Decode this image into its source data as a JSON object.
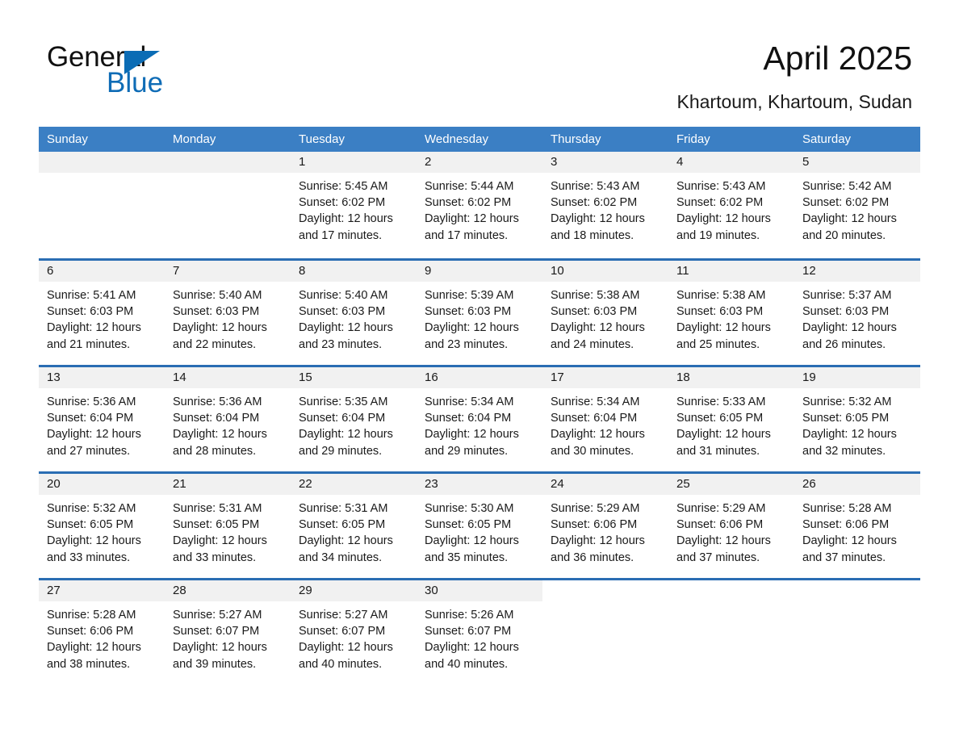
{
  "brand": {
    "name_part1": "General",
    "name_part2": "Blue",
    "accent_color": "#0f6cb6"
  },
  "header": {
    "title": "April 2025",
    "location": "Khartoum, Khartoum, Sudan"
  },
  "calendar": {
    "header_bg": "#3b7fc4",
    "row_divider_color": "#2a6db3",
    "daynum_bg": "#f1f1f1",
    "weekdays": [
      "Sunday",
      "Monday",
      "Tuesday",
      "Wednesday",
      "Thursday",
      "Friday",
      "Saturday"
    ],
    "weeks": [
      [
        {
          "day": "",
          "lines": []
        },
        {
          "day": "",
          "lines": []
        },
        {
          "day": "1",
          "lines": [
            "Sunrise: 5:45 AM",
            "Sunset: 6:02 PM",
            "Daylight: 12 hours",
            "and 17 minutes."
          ]
        },
        {
          "day": "2",
          "lines": [
            "Sunrise: 5:44 AM",
            "Sunset: 6:02 PM",
            "Daylight: 12 hours",
            "and 17 minutes."
          ]
        },
        {
          "day": "3",
          "lines": [
            "Sunrise: 5:43 AM",
            "Sunset: 6:02 PM",
            "Daylight: 12 hours",
            "and 18 minutes."
          ]
        },
        {
          "day": "4",
          "lines": [
            "Sunrise: 5:43 AM",
            "Sunset: 6:02 PM",
            "Daylight: 12 hours",
            "and 19 minutes."
          ]
        },
        {
          "day": "5",
          "lines": [
            "Sunrise: 5:42 AM",
            "Sunset: 6:02 PM",
            "Daylight: 12 hours",
            "and 20 minutes."
          ]
        }
      ],
      [
        {
          "day": "6",
          "lines": [
            "Sunrise: 5:41 AM",
            "Sunset: 6:03 PM",
            "Daylight: 12 hours",
            "and 21 minutes."
          ]
        },
        {
          "day": "7",
          "lines": [
            "Sunrise: 5:40 AM",
            "Sunset: 6:03 PM",
            "Daylight: 12 hours",
            "and 22 minutes."
          ]
        },
        {
          "day": "8",
          "lines": [
            "Sunrise: 5:40 AM",
            "Sunset: 6:03 PM",
            "Daylight: 12 hours",
            "and 23 minutes."
          ]
        },
        {
          "day": "9",
          "lines": [
            "Sunrise: 5:39 AM",
            "Sunset: 6:03 PM",
            "Daylight: 12 hours",
            "and 23 minutes."
          ]
        },
        {
          "day": "10",
          "lines": [
            "Sunrise: 5:38 AM",
            "Sunset: 6:03 PM",
            "Daylight: 12 hours",
            "and 24 minutes."
          ]
        },
        {
          "day": "11",
          "lines": [
            "Sunrise: 5:38 AM",
            "Sunset: 6:03 PM",
            "Daylight: 12 hours",
            "and 25 minutes."
          ]
        },
        {
          "day": "12",
          "lines": [
            "Sunrise: 5:37 AM",
            "Sunset: 6:03 PM",
            "Daylight: 12 hours",
            "and 26 minutes."
          ]
        }
      ],
      [
        {
          "day": "13",
          "lines": [
            "Sunrise: 5:36 AM",
            "Sunset: 6:04 PM",
            "Daylight: 12 hours",
            "and 27 minutes."
          ]
        },
        {
          "day": "14",
          "lines": [
            "Sunrise: 5:36 AM",
            "Sunset: 6:04 PM",
            "Daylight: 12 hours",
            "and 28 minutes."
          ]
        },
        {
          "day": "15",
          "lines": [
            "Sunrise: 5:35 AM",
            "Sunset: 6:04 PM",
            "Daylight: 12 hours",
            "and 29 minutes."
          ]
        },
        {
          "day": "16",
          "lines": [
            "Sunrise: 5:34 AM",
            "Sunset: 6:04 PM",
            "Daylight: 12 hours",
            "and 29 minutes."
          ]
        },
        {
          "day": "17",
          "lines": [
            "Sunrise: 5:34 AM",
            "Sunset: 6:04 PM",
            "Daylight: 12 hours",
            "and 30 minutes."
          ]
        },
        {
          "day": "18",
          "lines": [
            "Sunrise: 5:33 AM",
            "Sunset: 6:05 PM",
            "Daylight: 12 hours",
            "and 31 minutes."
          ]
        },
        {
          "day": "19",
          "lines": [
            "Sunrise: 5:32 AM",
            "Sunset: 6:05 PM",
            "Daylight: 12 hours",
            "and 32 minutes."
          ]
        }
      ],
      [
        {
          "day": "20",
          "lines": [
            "Sunrise: 5:32 AM",
            "Sunset: 6:05 PM",
            "Daylight: 12 hours",
            "and 33 minutes."
          ]
        },
        {
          "day": "21",
          "lines": [
            "Sunrise: 5:31 AM",
            "Sunset: 6:05 PM",
            "Daylight: 12 hours",
            "and 33 minutes."
          ]
        },
        {
          "day": "22",
          "lines": [
            "Sunrise: 5:31 AM",
            "Sunset: 6:05 PM",
            "Daylight: 12 hours",
            "and 34 minutes."
          ]
        },
        {
          "day": "23",
          "lines": [
            "Sunrise: 5:30 AM",
            "Sunset: 6:05 PM",
            "Daylight: 12 hours",
            "and 35 minutes."
          ]
        },
        {
          "day": "24",
          "lines": [
            "Sunrise: 5:29 AM",
            "Sunset: 6:06 PM",
            "Daylight: 12 hours",
            "and 36 minutes."
          ]
        },
        {
          "day": "25",
          "lines": [
            "Sunrise: 5:29 AM",
            "Sunset: 6:06 PM",
            "Daylight: 12 hours",
            "and 37 minutes."
          ]
        },
        {
          "day": "26",
          "lines": [
            "Sunrise: 5:28 AM",
            "Sunset: 6:06 PM",
            "Daylight: 12 hours",
            "and 37 minutes."
          ]
        }
      ],
      [
        {
          "day": "27",
          "lines": [
            "Sunrise: 5:28 AM",
            "Sunset: 6:06 PM",
            "Daylight: 12 hours",
            "and 38 minutes."
          ]
        },
        {
          "day": "28",
          "lines": [
            "Sunrise: 5:27 AM",
            "Sunset: 6:07 PM",
            "Daylight: 12 hours",
            "and 39 minutes."
          ]
        },
        {
          "day": "29",
          "lines": [
            "Sunrise: 5:27 AM",
            "Sunset: 6:07 PM",
            "Daylight: 12 hours",
            "and 40 minutes."
          ]
        },
        {
          "day": "30",
          "lines": [
            "Sunrise: 5:26 AM",
            "Sunset: 6:07 PM",
            "Daylight: 12 hours",
            "and 40 minutes."
          ]
        },
        {
          "day": "",
          "lines": []
        },
        {
          "day": "",
          "lines": []
        },
        {
          "day": "",
          "lines": []
        }
      ]
    ]
  }
}
